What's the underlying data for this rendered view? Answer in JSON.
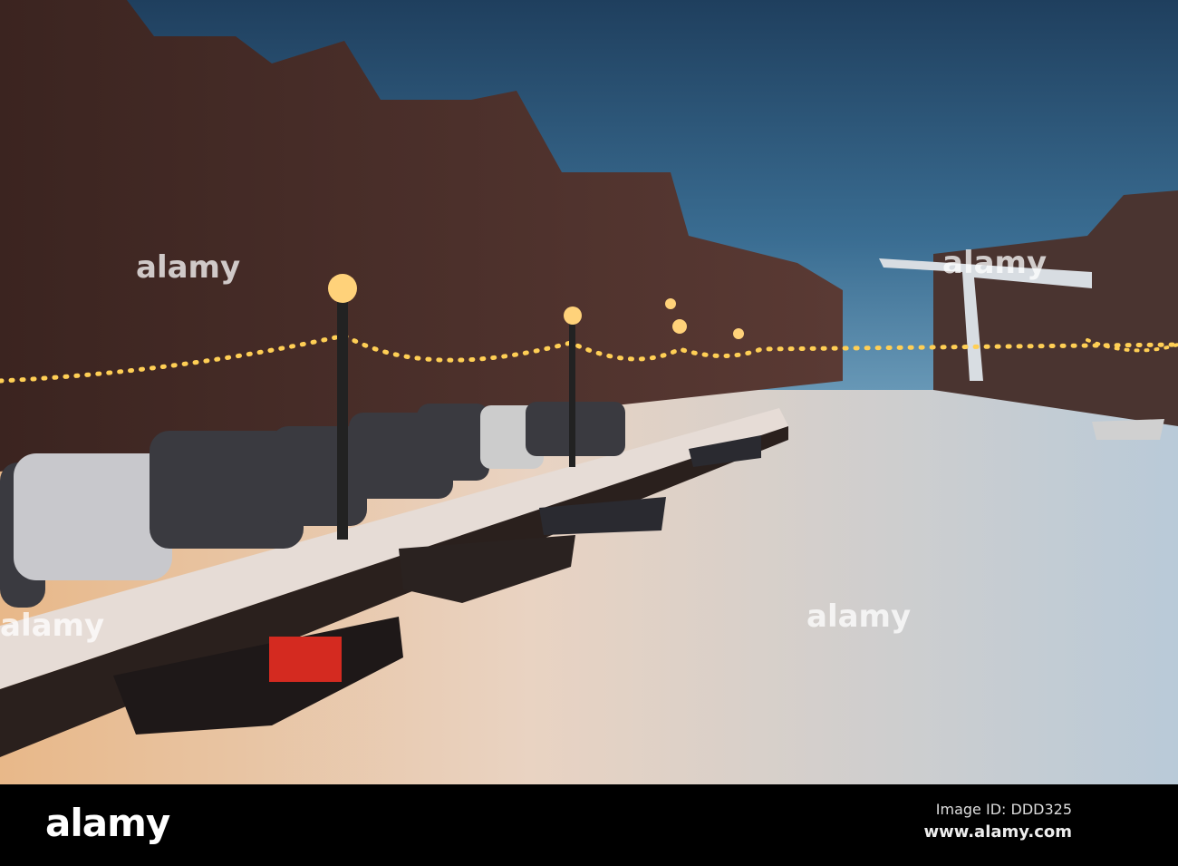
{
  "watermark": {
    "text": "alamy"
  },
  "footer": {
    "logo": "alamy",
    "image_id": "Image ID: DDD325",
    "website": "www.alamy.com"
  },
  "colors": {
    "sky": "#2d5878",
    "ice": "#cfd8e0",
    "lights": "#ffc94a",
    "brick": "#4a2a22"
  }
}
